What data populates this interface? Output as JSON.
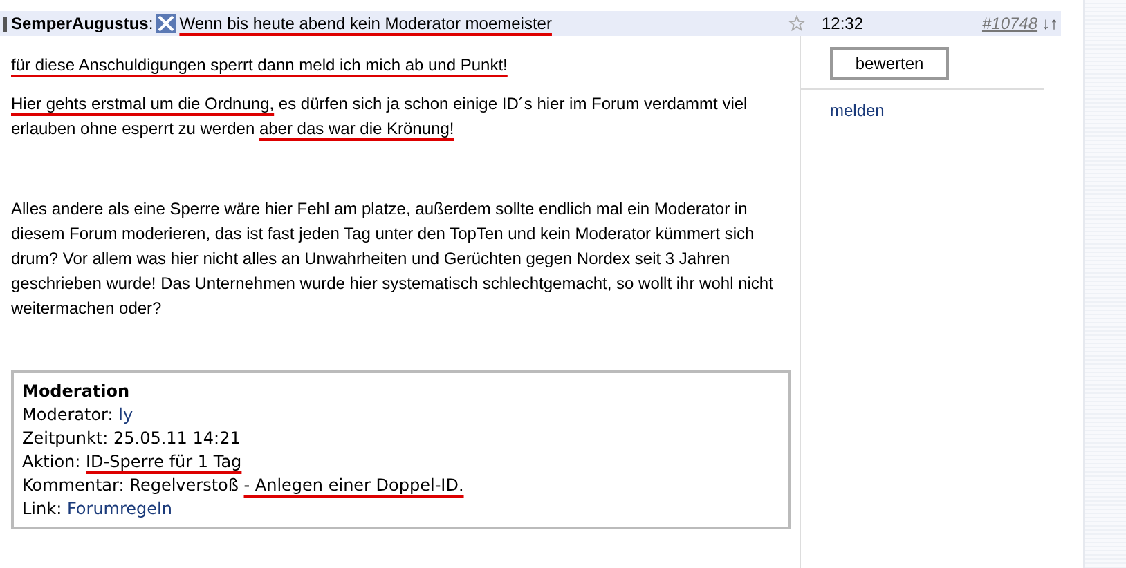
{
  "header": {
    "author": "SemperAugustus",
    "separator": ":",
    "title": "Wenn bis heute abend kein Moderator moemeister",
    "title_underlined": true,
    "time": "12:32",
    "post_number": "#10748",
    "arrows": "↓↑"
  },
  "paragraphs": [
    [
      {
        "text": "für diese Anschuldigungen sperrt dann meld ich mich ab und Punkt!",
        "underlined": true
      }
    ],
    [
      {
        "text": "Hier gehts erstmal um die Ordnung,",
        "underlined": true
      },
      {
        "text": " es dürfen sich ja schon einige ID´s hier im Forum verdammt viel erlauben ohne esperrt zu werden ",
        "underlined": false
      },
      {
        "text": "aber das war die Krönung!",
        "underlined": true
      }
    ],
    [
      {
        "text": "Alles andere als eine Sperre wäre hier Fehl am platze, außerdem sollte endlich mal ein Moderator in diesem Forum moderieren, das ist fast jeden Tag unter den TopTen und kein Moderator kümmert sich drum?  Vor allem was hier nicht alles an Unwahrheiten und Gerüchten gegen Nordex seit 3 Jahren geschrieben wurde!  Das Unternehmen wurde hier systematisch schlechtgemacht, so wollt ihr wohl nicht weitermachen oder?",
        "underlined": false
      }
    ]
  ],
  "moderation": {
    "title": "Moderation",
    "lines": [
      {
        "label": "Moderator:",
        "value": [
          {
            "text": "ly",
            "kind": "link",
            "underlined": false
          }
        ]
      },
      {
        "label": "Zeitpunkt:",
        "value": [
          {
            "text": "25.05.11 14:21",
            "kind": "text",
            "underlined": false
          }
        ]
      },
      {
        "label": "Aktion:",
        "value": [
          {
            "text": "ID-Sperre für 1 Tag",
            "kind": "text",
            "underlined": true
          }
        ]
      },
      {
        "label": "Kommentar:",
        "value": [
          {
            "text": "Regelverstoß ",
            "kind": "text",
            "underlined": false
          },
          {
            "text": "- Anlegen einer Doppel-ID.",
            "kind": "text",
            "underlined": true
          }
        ]
      },
      {
        "label": "Link:",
        "value": [
          {
            "text": "Forumregeln",
            "kind": "link",
            "underlined": false
          }
        ]
      }
    ]
  },
  "sidebar": {
    "button": "bewerten",
    "link": "melden"
  }
}
